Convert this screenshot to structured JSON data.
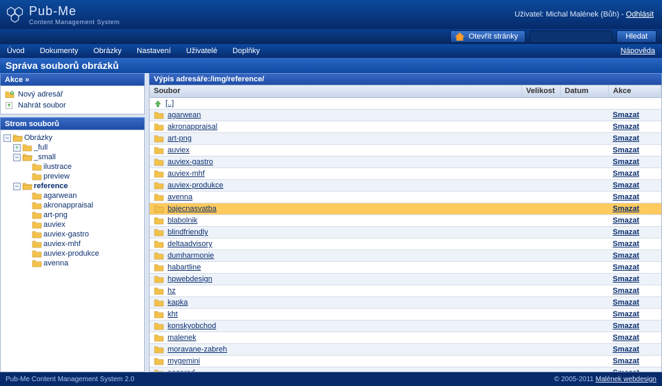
{
  "header": {
    "brand_name": "Pub-Me",
    "brand_sub": "Content Management System",
    "user_prefix": "Uživatel:",
    "user_name": "Michal Malének (Bůh)",
    "logout": "Odhlásit",
    "open_pages": "Otevřít stránky",
    "search_btn": "Hledat"
  },
  "menu": {
    "items": [
      "Úvod",
      "Dokumenty",
      "Obrázky",
      "Nastavení",
      "Uživatelé",
      "Doplňky"
    ],
    "help": "Nápověda"
  },
  "page_title": "Správa souborů obrázků",
  "actions_panel": {
    "title": "Akce »",
    "items": [
      {
        "icon": "new-folder",
        "label": "Nový adresář"
      },
      {
        "icon": "upload",
        "label": "Nahrát soubor"
      }
    ]
  },
  "tree_panel_title": "Strom souborů",
  "tree": {
    "label": "Obrázky",
    "open": true,
    "children": [
      {
        "label": "_full",
        "open": false,
        "children": []
      },
      {
        "label": "_small",
        "open": true,
        "children": [
          {
            "label": "ilustrace"
          },
          {
            "label": "preview"
          }
        ]
      },
      {
        "label": "reference",
        "open": true,
        "selected": true,
        "children": [
          {
            "label": "agarwean"
          },
          {
            "label": "akronappraisal"
          },
          {
            "label": "art-png"
          },
          {
            "label": "auviex"
          },
          {
            "label": "auviex-gastro"
          },
          {
            "label": "auviex-mhf"
          },
          {
            "label": "auviex-produkce"
          },
          {
            "label": "avenna"
          }
        ]
      }
    ]
  },
  "listing": {
    "header_prefix": "Výpis adresáře: ",
    "path": "/img/reference/",
    "cols": {
      "file": "Soubor",
      "size": "Velikost",
      "date": "Datum",
      "act": "Akce"
    },
    "up_label": "[..]",
    "dir_marker": "<DIR>",
    "delete_label": "Smazat",
    "rows": [
      {
        "name": "agarwean"
      },
      {
        "name": "akronappraisal"
      },
      {
        "name": "art-png"
      },
      {
        "name": "auviex"
      },
      {
        "name": "auviex-gastro"
      },
      {
        "name": "auviex-mhf"
      },
      {
        "name": "auviex-produkce"
      },
      {
        "name": "avenna"
      },
      {
        "name": "bajecnasvatba",
        "highlight": true
      },
      {
        "name": "blabolnik"
      },
      {
        "name": "blindfriendly"
      },
      {
        "name": "deltaadvisory"
      },
      {
        "name": "dumharmonie"
      },
      {
        "name": "habartline"
      },
      {
        "name": "hpwebdesign"
      },
      {
        "name": "hz"
      },
      {
        "name": "kapka"
      },
      {
        "name": "kht"
      },
      {
        "name": "konskyobchod"
      },
      {
        "name": "malenek"
      },
      {
        "name": "moravane-zabreh"
      },
      {
        "name": "mygemini"
      },
      {
        "name": "nazarad"
      }
    ]
  },
  "footer": {
    "left": "Pub-Me Content Management System 2.0",
    "copy": "© 2005-2011 ",
    "link": "Malének webdesign"
  }
}
